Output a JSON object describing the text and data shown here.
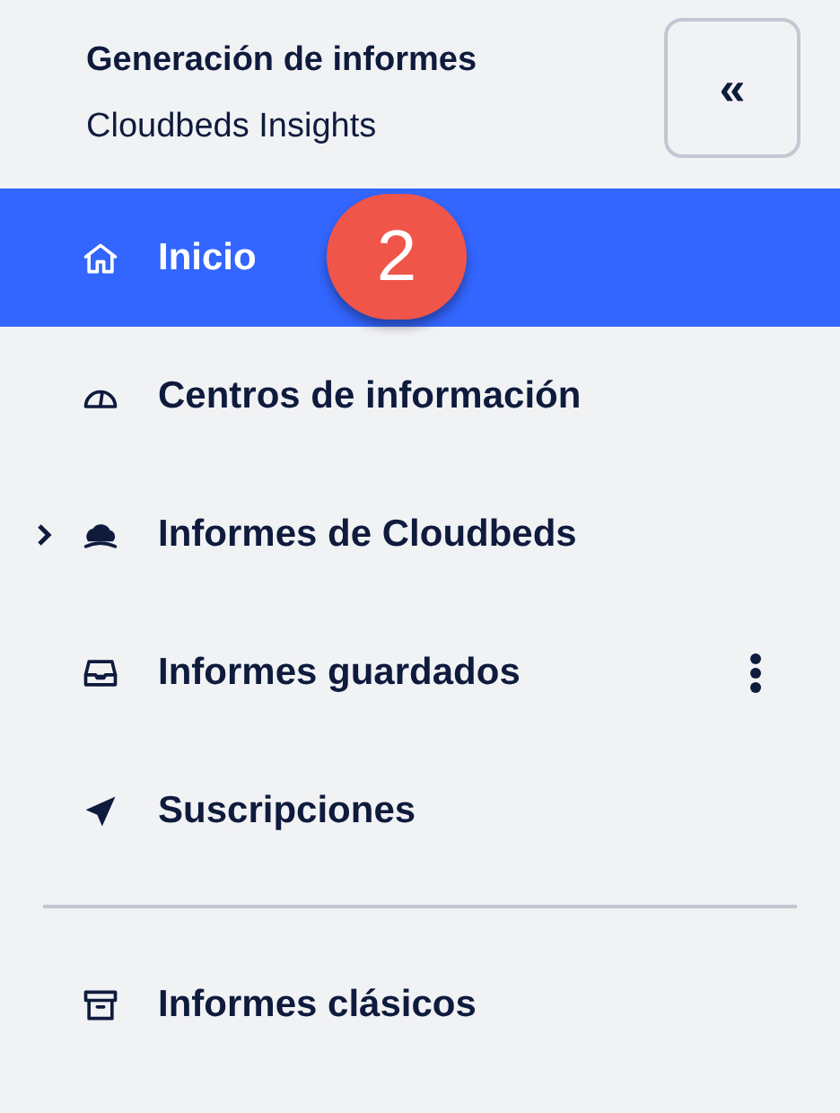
{
  "header": {
    "title": "Generación de informes",
    "subtitle": "Cloudbeds Insights"
  },
  "collapse_button": {
    "label": "«"
  },
  "step_badge": {
    "label": "2"
  },
  "nav": [
    {
      "label": "Inicio",
      "selected": true
    },
    {
      "label": "Centros de información",
      "selected": false
    },
    {
      "label": "Informes de Cloudbeds",
      "selected": false,
      "expanded": false
    },
    {
      "label": "Informes guardados",
      "selected": false,
      "has_menu": true
    },
    {
      "label": "Suscripciones",
      "selected": false
    }
  ],
  "nav_bottom": [
    {
      "label": "Informes clásicos",
      "selected": false
    }
  ]
}
